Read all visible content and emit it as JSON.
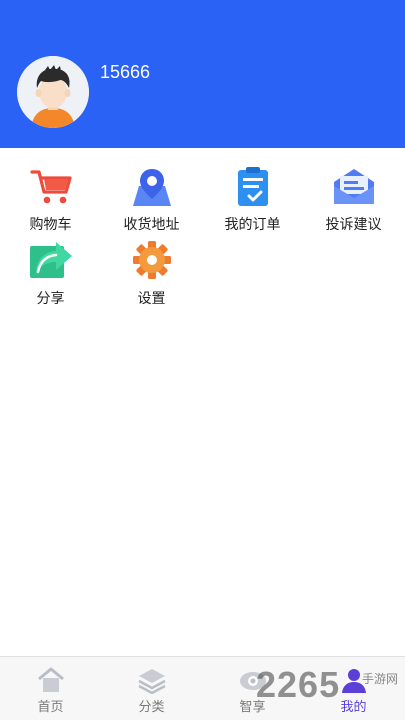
{
  "profile": {
    "username": "15666",
    "avatar_icon": "user-avatar-icon"
  },
  "menu": {
    "items": [
      {
        "label": "购物车",
        "icon": "shopping-cart-icon"
      },
      {
        "label": "收货地址",
        "icon": "map-pin-icon"
      },
      {
        "label": "我的订单",
        "icon": "clipboard-check-icon"
      },
      {
        "label": "投诉建议",
        "icon": "envelope-icon"
      },
      {
        "label": "分享",
        "icon": "share-arrow-icon"
      },
      {
        "label": "设置",
        "icon": "gear-icon"
      }
    ]
  },
  "tabbar": {
    "tabs": [
      {
        "label": "首页",
        "icon": "home-icon"
      },
      {
        "label": "分类",
        "icon": "layers-icon"
      },
      {
        "label": "智享",
        "icon": "eye-icon"
      },
      {
        "label": "我的",
        "icon": "user-icon",
        "active": true
      }
    ]
  },
  "watermark": {
    "text": "2265",
    "sub": "手游网"
  },
  "colors": {
    "header": "#2a62f5",
    "active_tab": "#5b3fd6"
  }
}
